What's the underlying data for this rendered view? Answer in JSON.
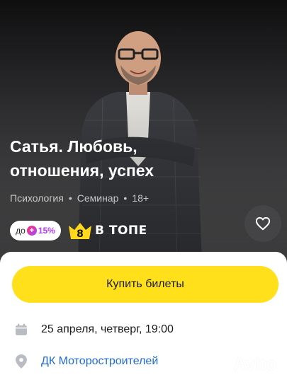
{
  "event": {
    "title": "Сатья. Любовь, отношения, успех",
    "category": "Психология",
    "type": "Семинар",
    "age": "18+",
    "separator": "•"
  },
  "badges": {
    "cashback_prefix": "до",
    "cashback_percent": "15%",
    "top_number": "8",
    "top_label": "В ТОПЕ"
  },
  "actions": {
    "buy_label": "Купить билеты"
  },
  "details": {
    "date": "25 апреля, четверг, 19:00",
    "venue": "ДК Моторостроителей"
  },
  "watermark": {
    "text": "Avito"
  },
  "colors": {
    "buy_button": "#ffe01a",
    "link": "#1f6bd8",
    "cashback_accent": "#b43cff",
    "top_badge": "#ffd81a"
  },
  "icons": {
    "favorite": "heart-icon",
    "date": "calendar-icon",
    "venue": "location-pin-icon",
    "cashback": "plus-icon",
    "top": "crown-icon"
  }
}
